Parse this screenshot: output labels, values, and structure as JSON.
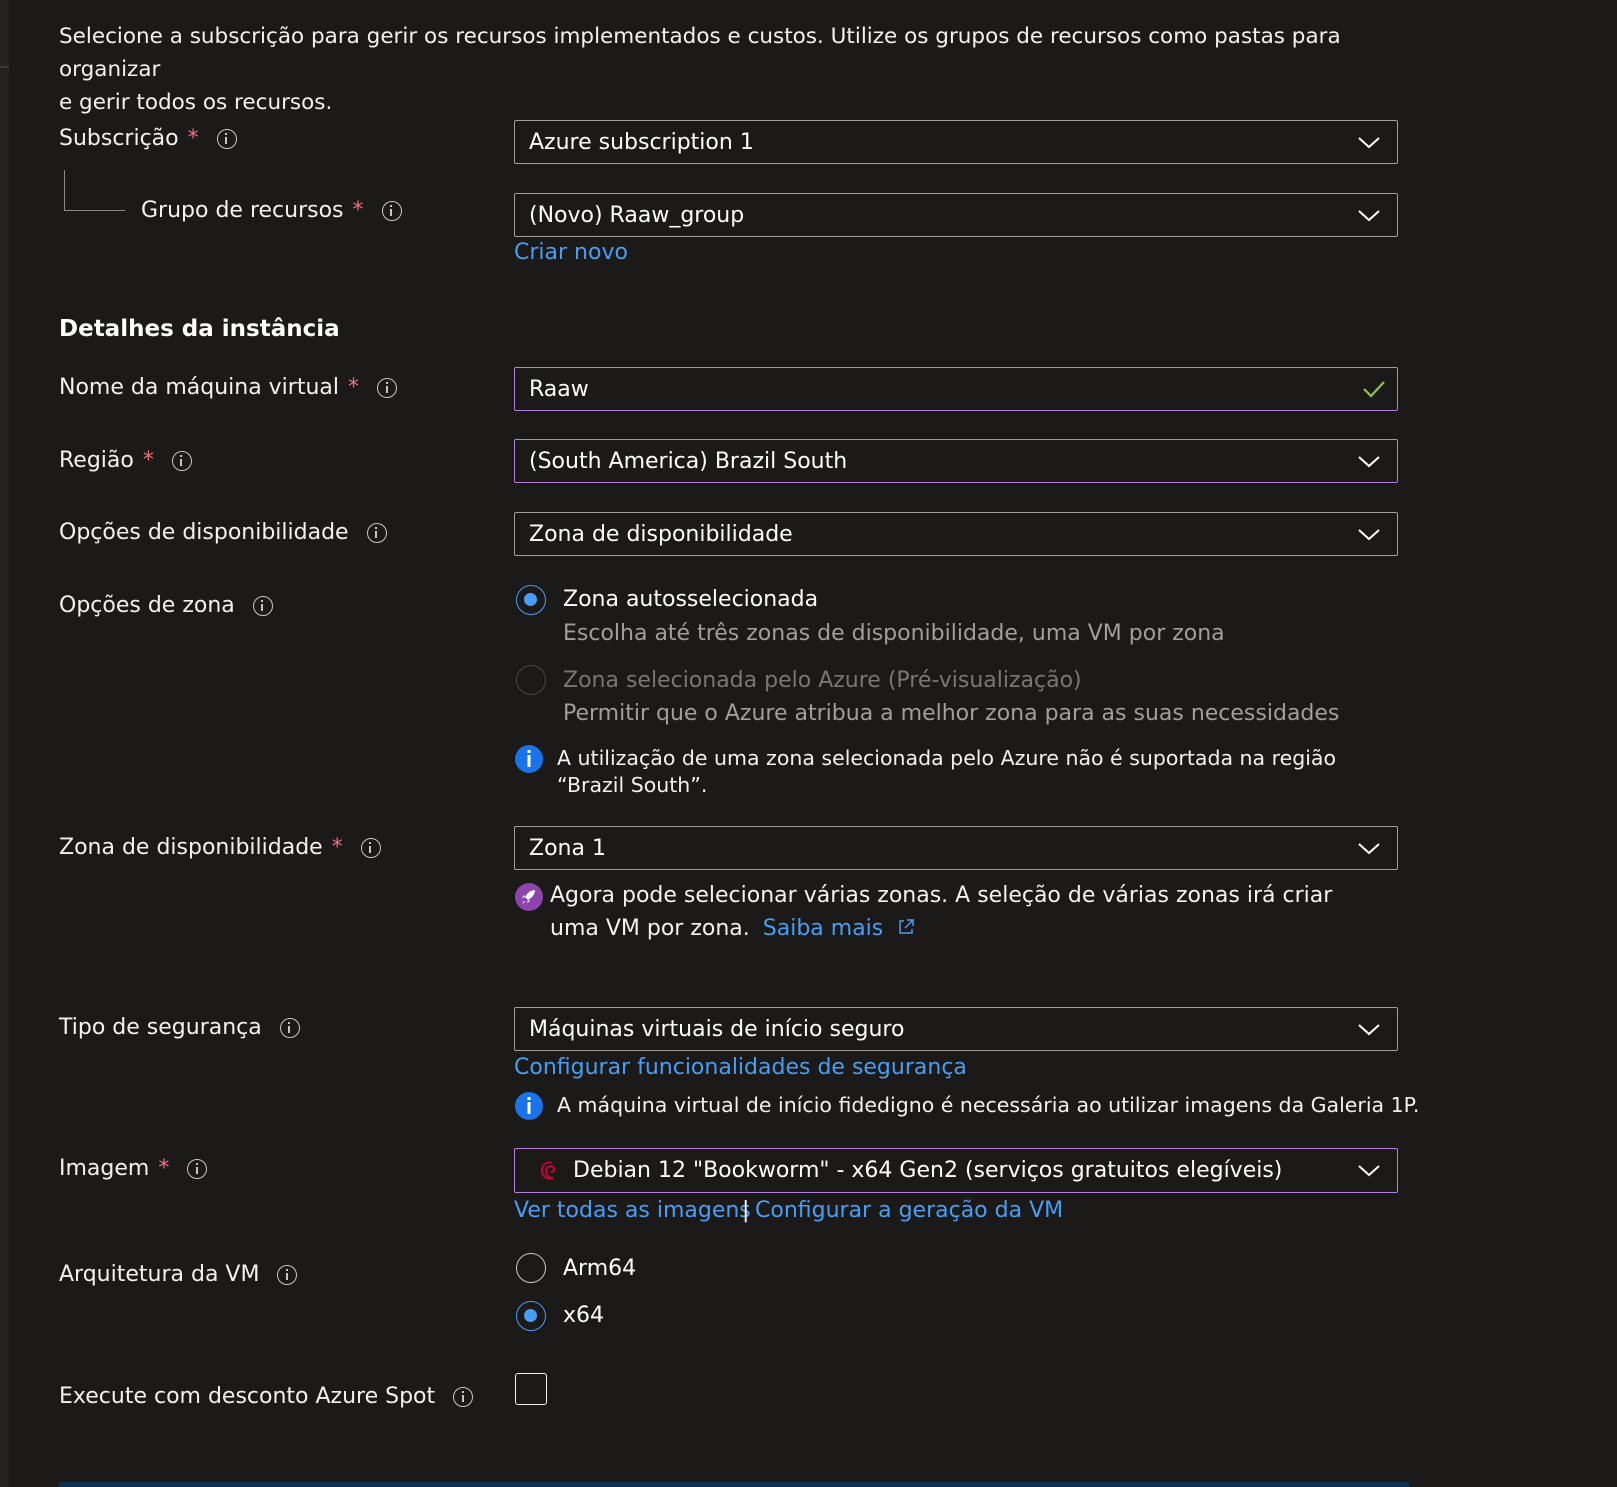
{
  "intro": {
    "line1": "Selecione a subscrição para gerir os recursos implementados e custos. Utilize os grupos de recursos como pastas para organizar",
    "line2": "e gerir todos os recursos."
  },
  "subscription": {
    "label": "Subscrição",
    "required": "*",
    "value": "Azure subscription 1"
  },
  "resource_group": {
    "label": "Grupo de recursos",
    "required": "*",
    "value": "(Novo) Raaw_group",
    "create_new": "Criar novo"
  },
  "instance_details": {
    "title": "Detalhes da instância"
  },
  "vm_name": {
    "label": "Nome da máquina virtual",
    "required": "*",
    "value": "Raaw"
  },
  "region": {
    "label": "Região",
    "required": "*",
    "value": "(South America) Brazil South"
  },
  "availability_options": {
    "label": "Opções de disponibilidade",
    "value": "Zona de disponibilidade"
  },
  "zone_options": {
    "label": "Opções de zona",
    "option1": {
      "title": "Zona autosselecionada",
      "desc": "Escolha até três zonas de disponibilidade, uma VM por zona",
      "selected": true
    },
    "option2": {
      "title": "Zona selecionada pelo Azure (Pré-visualização)",
      "desc": "Permitir que o Azure atribua a melhor zona para as suas necessidades",
      "disabled": true
    },
    "info": "A utilização de uma zona selecionada pelo Azure não é suportada na região “Brazil South”."
  },
  "availability_zone": {
    "label": "Zona de disponibilidade",
    "required": "*",
    "value": "Zona 1",
    "notice": "Agora pode selecionar várias zonas. A seleção de várias zonas irá criar uma VM por zona.",
    "learn_more": "Saiba mais"
  },
  "security_type": {
    "label": "Tipo de segurança",
    "value": "Máquinas virtuais de início seguro",
    "configure_link": "Configurar funcionalidades de segurança",
    "info": "A máquina virtual de início fidedigno é necessária ao utilizar imagens da Galeria 1P."
  },
  "image": {
    "label": "Imagem",
    "required": "*",
    "value": "Debian 12 \"Bookworm\" - x64 Gen2 (serviços gratuitos elegíveis)",
    "see_all": "Ver todas as imagens",
    "separator": "|",
    "configure_generation": "Configurar a geração da VM"
  },
  "vm_architecture": {
    "label": "Arquitetura da VM",
    "options": [
      "Arm64",
      "x64"
    ],
    "selected": "x64"
  },
  "spot": {
    "label": "Execute com desconto Azure Spot",
    "checked": false
  },
  "colors": {
    "background": "#1b1a19",
    "link": "#479ef5",
    "focus_border": "#b67fdf",
    "required": "#f1707b",
    "info_blue": "#1a73e8",
    "rocket_purple": "#8e44ad",
    "valid_check": "#8bc34a"
  }
}
